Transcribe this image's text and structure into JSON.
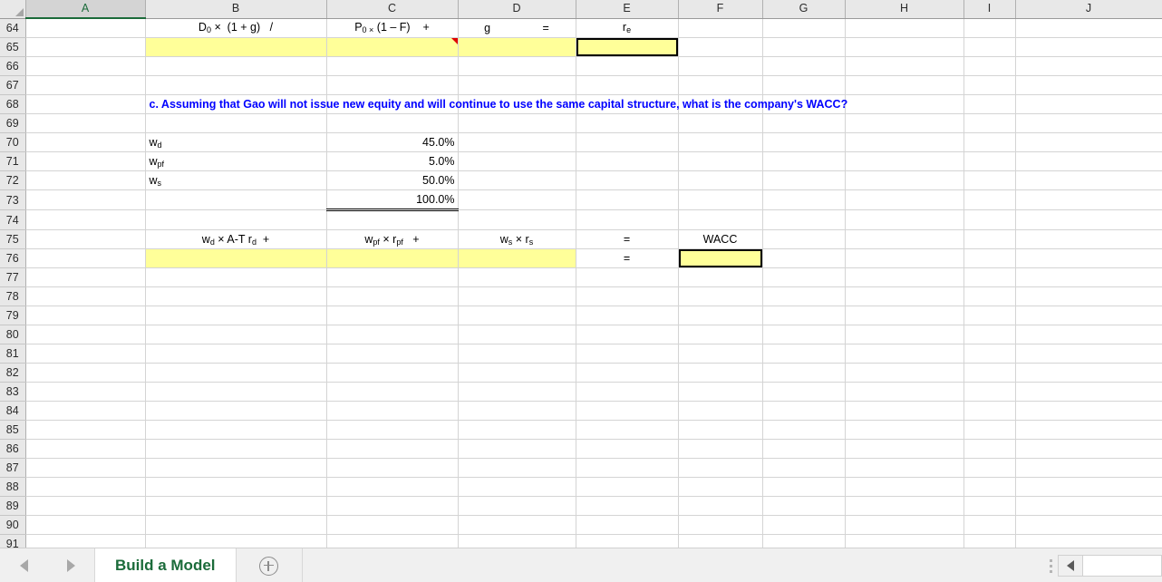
{
  "workbook": {
    "sheet_tab_label": "Build a Model",
    "add_sheet_icon": "plus-circle-icon",
    "prev_sheet_icon": "left-arrow-icon",
    "next_sheet_icon": "right-arrow-icon",
    "scroll_left_icon": "left-triangle-icon",
    "grip_icon": "grip-dots-icon"
  },
  "colors": {
    "input_fill": "#ffff99",
    "question_text": "#0000ff",
    "tab_text": "#1b6b3a",
    "selected_header": "#1b6b3a",
    "comment_flag": "#e00000"
  },
  "columns": [
    {
      "id": "A",
      "label": "A",
      "selected": true
    },
    {
      "id": "B",
      "label": "B",
      "selected": false
    },
    {
      "id": "C",
      "label": "C",
      "selected": false
    },
    {
      "id": "D",
      "label": "D",
      "selected": false
    },
    {
      "id": "E",
      "label": "E",
      "selected": false
    },
    {
      "id": "F",
      "label": "F",
      "selected": false
    },
    {
      "id": "G",
      "label": "G",
      "selected": false
    },
    {
      "id": "H",
      "label": "H",
      "selected": false
    },
    {
      "id": "I",
      "label": "I",
      "selected": false
    },
    {
      "id": "J",
      "label": "J",
      "selected": false
    }
  ],
  "row_numbers": [
    "64",
    "65",
    "66",
    "67",
    "68",
    "69",
    "70",
    "71",
    "72",
    "73",
    "74",
    "75",
    "76",
    "77",
    "78",
    "79",
    "80",
    "81",
    "82",
    "83",
    "84",
    "85",
    "86",
    "87",
    "88",
    "89",
    "90",
    "91"
  ],
  "cells": {
    "r64": {
      "B": {
        "text_parts": [
          "D",
          "0",
          " ×  (1 + g)   /"
        ]
      },
      "C": {
        "text_parts": [
          "P",
          "0 ×",
          " (1 – F)    +"
        ]
      },
      "D": {
        "g": "g",
        "eq": "="
      },
      "E": {
        "text_parts": [
          "r",
          "e"
        ]
      }
    },
    "r68": {
      "B": "c.  Assuming that Gao will not issue new equity and will continue to use  the same capital structure, what is the company's WACC?"
    },
    "r70": {
      "B_parts": [
        "w",
        "d"
      ],
      "C": "45.0%"
    },
    "r71": {
      "B_parts": [
        "w",
        "pf"
      ],
      "C": "5.0%"
    },
    "r72": {
      "B_parts": [
        "w",
        "s"
      ],
      "C": "50.0%"
    },
    "r73": {
      "C": "100.0%"
    },
    "r75": {
      "B_parts": [
        "w",
        "d",
        " × A-T r",
        "d",
        "   +"
      ],
      "C_parts": [
        "w",
        "pf",
        " × r",
        "pf",
        "    +"
      ],
      "D_parts": [
        "w",
        "s",
        " × r",
        "s"
      ],
      "E": "=",
      "F": "WACC"
    },
    "r76": {
      "E": "="
    }
  },
  "active_cell": "E65",
  "input_cells": [
    "B65",
    "C65",
    "D65",
    "E65",
    "B76",
    "C76",
    "D76",
    "F76"
  ],
  "boxed_cells": [
    "E65",
    "F76"
  ],
  "comment_cells": [
    "C65"
  ]
}
